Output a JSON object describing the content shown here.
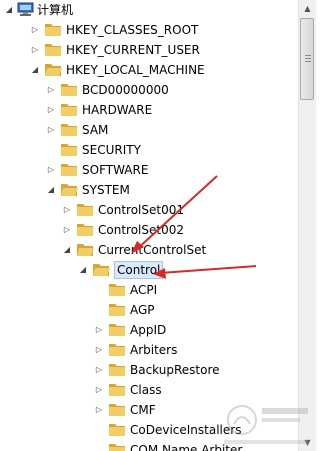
{
  "root": {
    "label": "计算机",
    "icon": "computer-icon"
  },
  "tree": [
    {
      "label": "HKEY_CLASSES_ROOT",
      "expander": "collapsed"
    },
    {
      "label": "HKEY_CURRENT_USER",
      "expander": "collapsed"
    },
    {
      "label": "HKEY_LOCAL_MACHINE",
      "expander": "expanded"
    },
    {
      "label": "BCD00000000",
      "expander": "collapsed"
    },
    {
      "label": "HARDWARE",
      "expander": "collapsed"
    },
    {
      "label": "SAM",
      "expander": "collapsed"
    },
    {
      "label": "SECURITY",
      "expander": "none"
    },
    {
      "label": "SOFTWARE",
      "expander": "collapsed"
    },
    {
      "label": "SYSTEM",
      "expander": "expanded"
    },
    {
      "label": "ControlSet001",
      "expander": "collapsed"
    },
    {
      "label": "ControlSet002",
      "expander": "collapsed"
    },
    {
      "label": "CurrentControlSet",
      "expander": "expanded"
    },
    {
      "label": "Control",
      "expander": "expanded",
      "selected": true
    },
    {
      "label": "ACPI",
      "expander": "none"
    },
    {
      "label": "AGP",
      "expander": "none"
    },
    {
      "label": "AppID",
      "expander": "collapsed"
    },
    {
      "label": "Arbiters",
      "expander": "collapsed"
    },
    {
      "label": "BackupRestore",
      "expander": "collapsed"
    },
    {
      "label": "Class",
      "expander": "collapsed"
    },
    {
      "label": "CMF",
      "expander": "collapsed"
    },
    {
      "label": "CoDeviceInstallers",
      "expander": "none"
    },
    {
      "label": "COM Name Arbiter",
      "expander": "none"
    }
  ],
  "colors": {
    "folder_fill": "#f2cd66",
    "folder_dark": "#d7a531",
    "annotation_arrow": "#d42a2a",
    "selection": "#d9e8fb"
  }
}
